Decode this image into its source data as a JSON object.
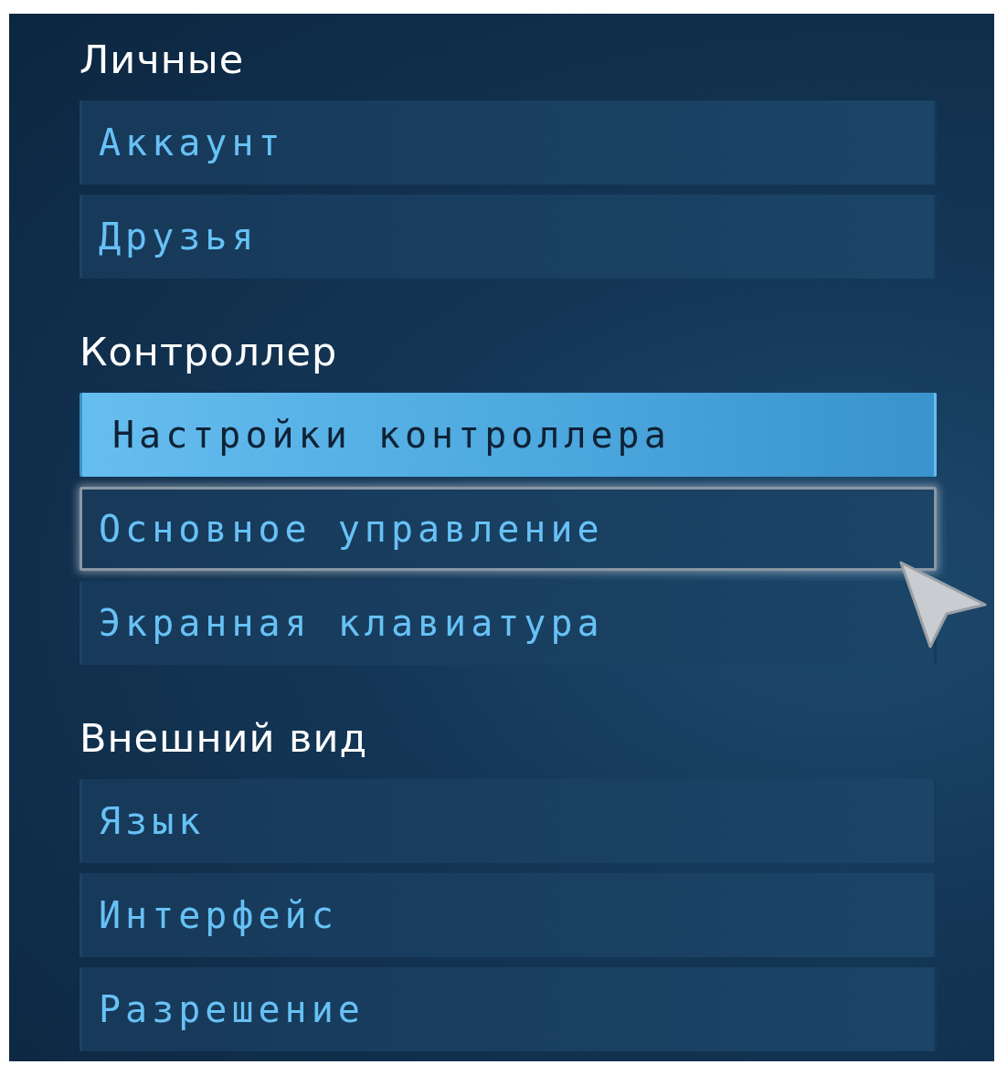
{
  "sections": [
    {
      "heading": "Личные",
      "items": [
        {
          "label": "Аккаунт",
          "selected": false,
          "focused": false
        },
        {
          "label": "Друзья",
          "selected": false,
          "focused": false
        }
      ]
    },
    {
      "heading": "Контроллер",
      "items": [
        {
          "label": "Настройки контроллера",
          "selected": true,
          "focused": false
        },
        {
          "label": "Основное управление",
          "selected": false,
          "focused": true
        },
        {
          "label": "Экранная клавиатура",
          "selected": false,
          "focused": false
        }
      ]
    },
    {
      "heading": "Внешний вид",
      "items": [
        {
          "label": "Язык",
          "selected": false,
          "focused": false
        },
        {
          "label": "Интерфейс",
          "selected": false,
          "focused": false
        },
        {
          "label": "Разрешение",
          "selected": false,
          "focused": false
        }
      ]
    }
  ]
}
